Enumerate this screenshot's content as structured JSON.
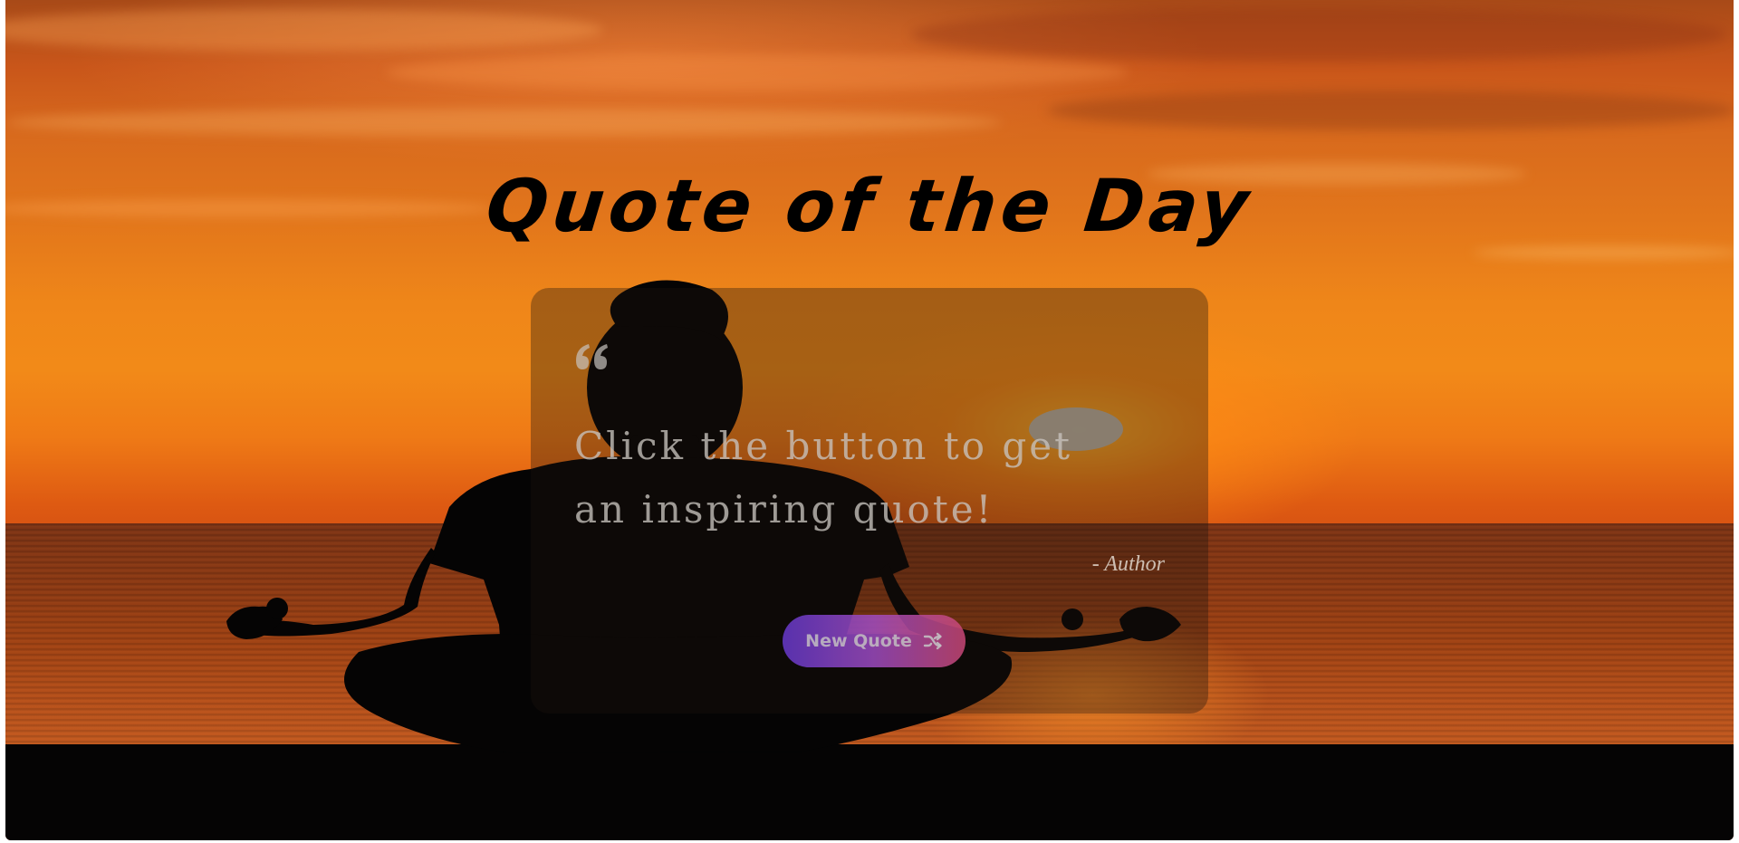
{
  "page": {
    "title": "Quote of the Day"
  },
  "quote": {
    "text": "Click the button to get an inspiring quote!",
    "author": "- Author"
  },
  "button": {
    "label": "New Quote",
    "icon": "shuffle-icon"
  },
  "icons": {
    "quote_mark": "quote-left-icon"
  },
  "colors": {
    "title": "#000000",
    "button_gradient_start": "#6a3bd3",
    "button_gradient_end": "#d04a7a",
    "sky_orange": "#f28a18"
  }
}
